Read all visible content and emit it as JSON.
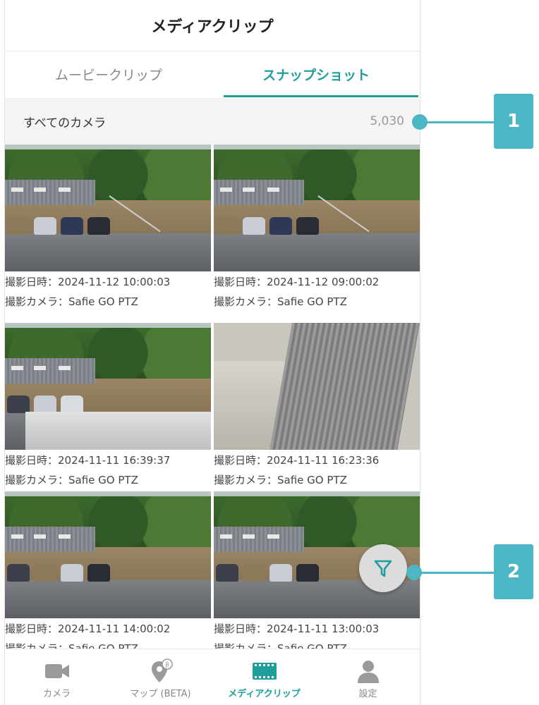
{
  "header": {
    "title": "メディアクリップ"
  },
  "tabs": [
    {
      "label": "ムービークリップ",
      "active": false
    },
    {
      "label": "スナップショット",
      "active": true
    }
  ],
  "filter": {
    "camera": "すべてのカメラ",
    "count": "5,030"
  },
  "snapshots": [
    {
      "date": "撮影日時：2024-11-12 10:00:03",
      "camera": "撮影カメラ：Safie GO PTZ"
    },
    {
      "date": "撮影日時：2024-11-12 09:00:02",
      "camera": "撮影カメラ：Safie GO PTZ"
    },
    {
      "date": "撮影日時：2024-11-11 16:39:37",
      "camera": "撮影カメラ：Safie GO PTZ"
    },
    {
      "date": "撮影日時：2024-11-11 16:23:36",
      "camera": "撮影カメラ：Safie GO PTZ"
    },
    {
      "date": "撮影日時：2024-11-11 14:00:02",
      "camera": "撮影カメラ：Safie GO PTZ"
    },
    {
      "date": "撮影日時：2024-11-11 13:00:03",
      "camera": "撮影カメラ：Safie GO PTZ"
    }
  ],
  "bottom_nav": [
    {
      "label": "カメラ",
      "icon": "camera-icon",
      "active": false
    },
    {
      "label": "マップ (BETA)",
      "icon": "map-pin-beta-icon",
      "active": false
    },
    {
      "label": "メディアクリップ",
      "icon": "film-icon",
      "active": true
    },
    {
      "label": "設定",
      "icon": "user-icon",
      "active": false
    }
  ],
  "callouts": [
    {
      "label": "1"
    },
    {
      "label": "2"
    }
  ],
  "colors": {
    "accent": "#1f9e9a",
    "callout": "#4db6c4",
    "inactive": "#888888"
  }
}
